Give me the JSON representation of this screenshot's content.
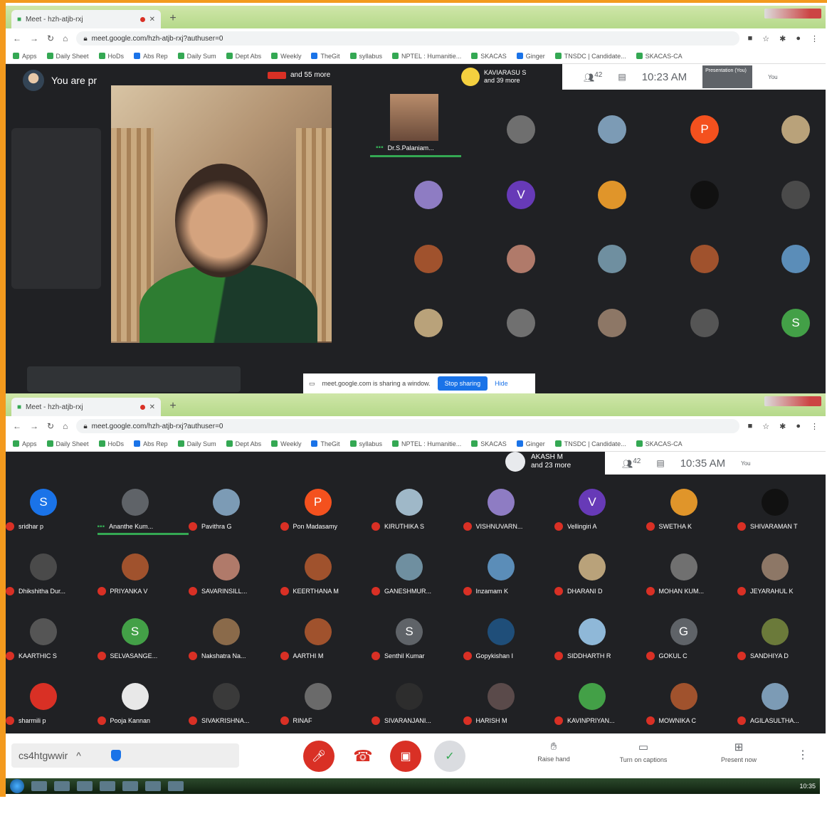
{
  "shot1": {
    "tab_title": "Meet - hzh-atjb-rxj",
    "url": "meet.google.com/hzh-atjb-rxj?authuser=0",
    "bookmarks": [
      "Apps",
      "Daily Sheet",
      "HoDs",
      "Abs Rep",
      "Daily Sum",
      "Dept Abs",
      "Weekly",
      "TheGit",
      "syllabus",
      "NPTEL : Humanitie...",
      "SKACAS",
      "Ginger",
      "TNSDC | Candidate...",
      "SKACAS-CA"
    ],
    "you_are": "You are pr",
    "presenting_more": "and 55 more",
    "top_speaker": "KAVIARASU S",
    "top_speaker_more": "and 39 more",
    "participants_count": "42",
    "time": "10:23 AM",
    "presentation_label": "Presentation (You)",
    "self_label": "You",
    "main_tile_name": "Dr.S.Palaniam...",
    "grid_letters": [
      "P",
      "V",
      "S"
    ],
    "share_message": "meet.google.com is sharing a window.",
    "stop_sharing": "Stop sharing",
    "hide": "Hide"
  },
  "shot2": {
    "tab_title": "Meet - hzh-atjb-rxj",
    "url": "meet.google.com/hzh-atjb-rxj?authuser=0",
    "bookmarks": [
      "Apps",
      "Daily Sheet",
      "HoDs",
      "Abs Rep",
      "Daily Sum",
      "Dept Abs",
      "Weekly",
      "TheGit",
      "syllabus",
      "NPTEL : Humanitie...",
      "SKACAS",
      "Ginger",
      "TNSDC | Candidate...",
      "SKACAS-CA"
    ],
    "top_speaker": "AKASH M",
    "top_speaker_more": "and 23 more",
    "participants_count": "42",
    "time": "10:35 AM",
    "self_label": "You",
    "participants": [
      {
        "name": "sridhar p",
        "letter": "S",
        "color": "#1a73e8",
        "speaking": false
      },
      {
        "name": "Ananthe Kum...",
        "letter": "",
        "color": "#5f6368",
        "speaking": true
      },
      {
        "name": "Pavithra G",
        "letter": "",
        "color": "#7c9bb5",
        "speaking": false
      },
      {
        "name": "Pon Madasamy",
        "letter": "P",
        "color": "#f4511e",
        "speaking": false
      },
      {
        "name": "KIRUTHIKA S",
        "letter": "",
        "color": "#9fb8c8",
        "speaking": false
      },
      {
        "name": "VISHNUVARN...",
        "letter": "",
        "color": "#8e7cc3",
        "speaking": false
      },
      {
        "name": "Vellingiri A",
        "letter": "V",
        "color": "#673ab7",
        "speaking": false
      },
      {
        "name": "SWETHA K",
        "letter": "",
        "color": "#e0952a",
        "speaking": false
      },
      {
        "name": "SHIVARAMAN T",
        "letter": "",
        "color": "#111111",
        "speaking": false
      },
      {
        "name": "Dhikshitha Dur...",
        "letter": "",
        "color": "#4a4a4a",
        "speaking": false
      },
      {
        "name": "PRIYANKA V",
        "letter": "",
        "color": "#a0522d",
        "speaking": false
      },
      {
        "name": "SAVARINSILL...",
        "letter": "",
        "color": "#b07a6a",
        "speaking": false
      },
      {
        "name": "KEERTHANA M",
        "letter": "",
        "color": "#a0522d",
        "speaking": false
      },
      {
        "name": "GANESHMUR...",
        "letter": "",
        "color": "#6f8fa0",
        "speaking": false
      },
      {
        "name": "Inzamam K",
        "letter": "",
        "color": "#5b8db8",
        "speaking": false
      },
      {
        "name": "DHARANI D",
        "letter": "",
        "color": "#b9a27a",
        "speaking": false
      },
      {
        "name": "MOHAN KUM...",
        "letter": "",
        "color": "#707070",
        "speaking": false
      },
      {
        "name": "JEYARAHUL K",
        "letter": "",
        "color": "#8d7766",
        "speaking": false
      },
      {
        "name": "KAARTHIC S",
        "letter": "",
        "color": "#555555",
        "speaking": false
      },
      {
        "name": "SELVASANGE...",
        "letter": "S",
        "color": "#43a047",
        "speaking": false
      },
      {
        "name": "Nakshatra Na...",
        "letter": "",
        "color": "#8a6a4a",
        "speaking": false
      },
      {
        "name": "AARTHI M",
        "letter": "",
        "color": "#a0522d",
        "speaking": false
      },
      {
        "name": "Senthil Kumar",
        "letter": "S",
        "color": "#5f6368",
        "speaking": false
      },
      {
        "name": "Gopykishan I",
        "letter": "",
        "color": "#1f4e79",
        "speaking": false
      },
      {
        "name": "SIDDHARTH R",
        "letter": "",
        "color": "#8fb8d8",
        "speaking": false
      },
      {
        "name": "GOKUL C",
        "letter": "G",
        "color": "#5f6368",
        "speaking": false
      },
      {
        "name": "SANDHIYA D",
        "letter": "",
        "color": "#6b7a3a",
        "speaking": false
      },
      {
        "name": "sharmili p",
        "letter": "",
        "color": "#d93025",
        "speaking": false
      },
      {
        "name": "Pooja Kannan",
        "letter": "",
        "color": "#e8e8e8",
        "speaking": false
      },
      {
        "name": "SIVAKRISHNA...",
        "letter": "",
        "color": "#3a3a3a",
        "speaking": false
      },
      {
        "name": "RINAF",
        "letter": "",
        "color": "#6a6a6a",
        "speaking": false
      },
      {
        "name": "SIVARANJANI...",
        "letter": "",
        "color": "#2d2d2d",
        "speaking": false
      },
      {
        "name": "HARISH M",
        "letter": "",
        "color": "#5a4a4a",
        "speaking": false
      },
      {
        "name": "KAVINPRIYAN...",
        "letter": "",
        "color": "#43a047",
        "speaking": false
      },
      {
        "name": "MOWNIKA C",
        "letter": "",
        "color": "#a0522d",
        "speaking": false
      },
      {
        "name": "AGILASULTHA...",
        "letter": "",
        "color": "#7c9bb5",
        "speaking": false
      }
    ],
    "meeting_code": "cs4htgwwir",
    "raise_hand": "Raise hand",
    "captions": "Turn on captions",
    "present_now": "Present now",
    "clock": "10:35"
  },
  "colors": {
    "meet_bg": "#202124",
    "accent_red": "#d93025",
    "accent_green": "#34a853",
    "accent_blue": "#1a73e8",
    "frame_orange": "#f39a1e"
  },
  "icons": [
    "search-icon",
    "star-icon",
    "mic-off-icon",
    "hangup-icon",
    "camera-off-icon",
    "check-icon",
    "raise-hand-icon",
    "captions-icon",
    "present-icon",
    "more-icon"
  ]
}
